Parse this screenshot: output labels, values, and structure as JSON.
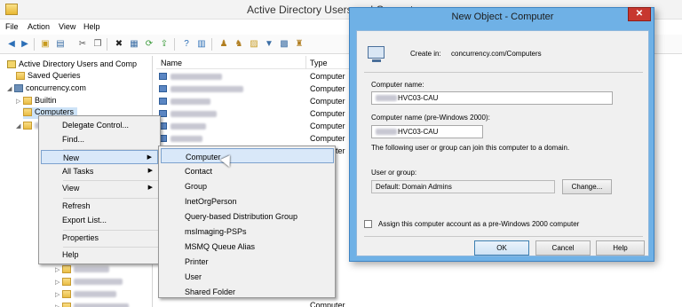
{
  "window": {
    "title": "Active Directory Users and Computers"
  },
  "menubar": {
    "file": "File",
    "action": "Action",
    "view": "View",
    "help": "Help"
  },
  "toolbar": {
    "icons": [
      "back-icon",
      "forward-icon",
      "up-icon",
      "details-icon",
      "cut-icon",
      "copy-icon",
      "delete-icon",
      "properties-icon",
      "refresh-icon",
      "export-icon",
      "help-icon",
      "console-icon",
      "new-user-icon",
      "new-group-icon",
      "new-ou-icon",
      "filter-icon",
      "find-icon",
      "delegate-icon"
    ]
  },
  "tree": {
    "root": "Active Directory Users and Comp",
    "saved_queries": "Saved Queries",
    "domain": "concurrency.com",
    "builtin": "Builtin",
    "computers": "Computers"
  },
  "list": {
    "col_name": "Name",
    "col_type": "Type",
    "rows": [
      {
        "type": "Computer"
      },
      {
        "type": "Computer"
      },
      {
        "type": "Computer"
      },
      {
        "type": "Computer"
      },
      {
        "type": "Computer"
      },
      {
        "type": "Computer"
      },
      {
        "type": "Computer"
      }
    ],
    "partial_type": "Computer"
  },
  "context_menu": {
    "delegate": "Delegate Control...",
    "find": "Find...",
    "new": "New",
    "all_tasks": "All Tasks",
    "view": "View",
    "refresh": "Refresh",
    "export": "Export List...",
    "properties": "Properties",
    "help": "Help"
  },
  "new_submenu": {
    "items": [
      "Computer",
      "Contact",
      "Group",
      "InetOrgPerson",
      "Query-based Distribution Group",
      "msImaging-PSPs",
      "MSMQ Queue Alias",
      "Printer",
      "User",
      "Shared Folder"
    ],
    "highlighted": "Computer"
  },
  "dialog": {
    "title": "New Object - Computer",
    "close": "✕",
    "create_in_label": "Create in:",
    "create_in_value": "concurrency.com/Computers",
    "computer_name_label": "Computer name:",
    "computer_name_value": "HVC03-CAU",
    "pre2000_label": "Computer name (pre-Windows 2000):",
    "pre2000_value": "HVC03-CAU",
    "join_text": "The following user or group can join this computer to a domain.",
    "user_group_label": "User or group:",
    "user_group_value": "Default: Domain Admins",
    "change_button": "Change...",
    "assign_checkbox": "Assign this computer account as a pre-Windows 2000 computer",
    "assign_checked": false,
    "ok": "OK",
    "cancel": "Cancel",
    "help": "Help"
  }
}
